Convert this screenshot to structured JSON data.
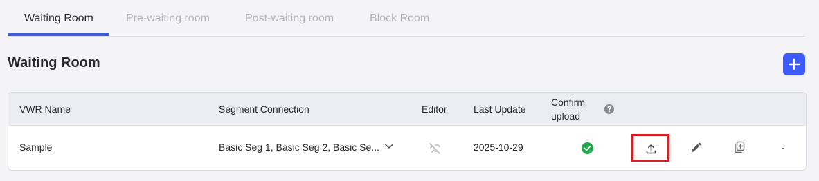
{
  "tabs": [
    {
      "label": "Waiting Room"
    },
    {
      "label": "Pre-waiting room"
    },
    {
      "label": "Post-waiting room"
    },
    {
      "label": "Block Room"
    }
  ],
  "page_title": "Waiting Room",
  "table": {
    "headers": {
      "vwr_name": "VWR Name",
      "segment_connection": "Segment Connection",
      "editor": "Editor",
      "last_update": "Last Update",
      "confirm_upload_line1": "Confirm",
      "confirm_upload_line2": "upload"
    },
    "rows": [
      {
        "vwr_name": "Sample",
        "segment_connection": "Basic Seg 1, Basic Seg 2, Basic Se...",
        "last_update": "2025-10-29",
        "last_col": "-"
      }
    ]
  },
  "colors": {
    "accent": "#3d5afe",
    "success": "#1fa94b",
    "highlight": "#d92027"
  }
}
